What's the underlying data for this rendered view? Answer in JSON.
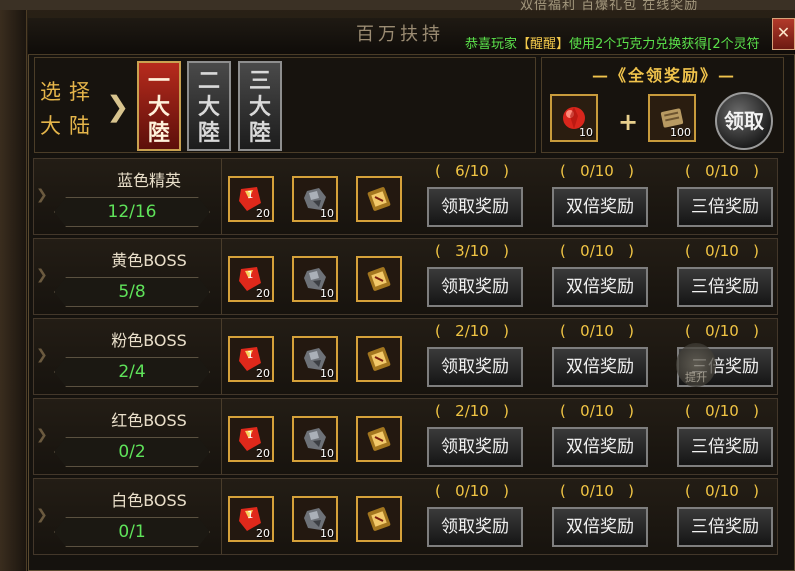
{
  "top_strip_text": "双倍福利   百爆礼包   在线奖励",
  "window": {
    "title": "百万扶持",
    "close_label": "✕"
  },
  "broadcast": {
    "prefix": "恭喜玩家",
    "name": "【醒醒】",
    "suffix": "使用2个巧克力兑换获得[2个灵符"
  },
  "selector": {
    "label_line1": "选择",
    "label_line2": "大陆",
    "arrow": "❯",
    "continents": [
      {
        "label": "一大陸",
        "active": true
      },
      {
        "label": "二大陸",
        "active": false
      },
      {
        "label": "三大陸",
        "active": false
      }
    ]
  },
  "full_reward": {
    "title": "—《全领奖励》—",
    "items": [
      {
        "icon": "red-gem-icon",
        "count": "10"
      },
      {
        "icon": "scroll-bundle-icon",
        "count": "100"
      }
    ],
    "plus": "+",
    "claim_label": "领取"
  },
  "rows": [
    {
      "name": "蓝色精英",
      "progress": "12/16",
      "rewards": [
        {
          "icon": "red-charm-icon",
          "count": "20"
        },
        {
          "icon": "iron-ore-icon",
          "count": "10"
        },
        {
          "icon": "golden-scroll-icon",
          "count": ""
        }
      ],
      "tiers": [
        {
          "value": "6/10",
          "button": "领取奖励"
        },
        {
          "value": "0/10",
          "button": "双倍奖励"
        },
        {
          "value": "0/10",
          "button": "三倍奖励"
        }
      ]
    },
    {
      "name": "黄色BOSS",
      "progress": "5/8",
      "rewards": [
        {
          "icon": "red-charm-icon",
          "count": "20"
        },
        {
          "icon": "iron-ore-icon",
          "count": "10"
        },
        {
          "icon": "golden-scroll-icon",
          "count": ""
        }
      ],
      "tiers": [
        {
          "value": "3/10",
          "button": "领取奖励"
        },
        {
          "value": "0/10",
          "button": "双倍奖励"
        },
        {
          "value": "0/10",
          "button": "三倍奖励"
        }
      ]
    },
    {
      "name": "粉色BOSS",
      "progress": "2/4",
      "rewards": [
        {
          "icon": "red-charm-icon",
          "count": "20"
        },
        {
          "icon": "iron-ore-icon",
          "count": "10"
        },
        {
          "icon": "golden-scroll-icon",
          "count": ""
        }
      ],
      "tiers": [
        {
          "value": "2/10",
          "button": "领取奖励"
        },
        {
          "value": "0/10",
          "button": "双倍奖励"
        },
        {
          "value": "0/10",
          "button": "三倍奖励"
        }
      ]
    },
    {
      "name": "红色BOSS",
      "progress": "0/2",
      "rewards": [
        {
          "icon": "red-charm-icon",
          "count": "20"
        },
        {
          "icon": "iron-ore-icon",
          "count": "10"
        },
        {
          "icon": "golden-scroll-icon",
          "count": ""
        }
      ],
      "tiers": [
        {
          "value": "2/10",
          "button": "领取奖励"
        },
        {
          "value": "0/10",
          "button": "双倍奖励"
        },
        {
          "value": "0/10",
          "button": "三倍奖励"
        }
      ]
    },
    {
      "name": "白色BOSS",
      "progress": "0/1",
      "rewards": [
        {
          "icon": "red-charm-icon",
          "count": "20"
        },
        {
          "icon": "iron-ore-icon",
          "count": "10"
        },
        {
          "icon": "golden-scroll-icon",
          "count": ""
        }
      ],
      "tiers": [
        {
          "value": "0/10",
          "button": "领取奖励"
        },
        {
          "value": "0/10",
          "button": "双倍奖励"
        },
        {
          "value": "0/10",
          "button": "三倍奖励"
        }
      ]
    }
  ],
  "upgrade_badge": "提升",
  "colors": {
    "accent_gold": "#f1c544",
    "progress_green": "#5fe35a",
    "broadcast_green": "#5be34b",
    "active_red": "#b72b1d"
  }
}
